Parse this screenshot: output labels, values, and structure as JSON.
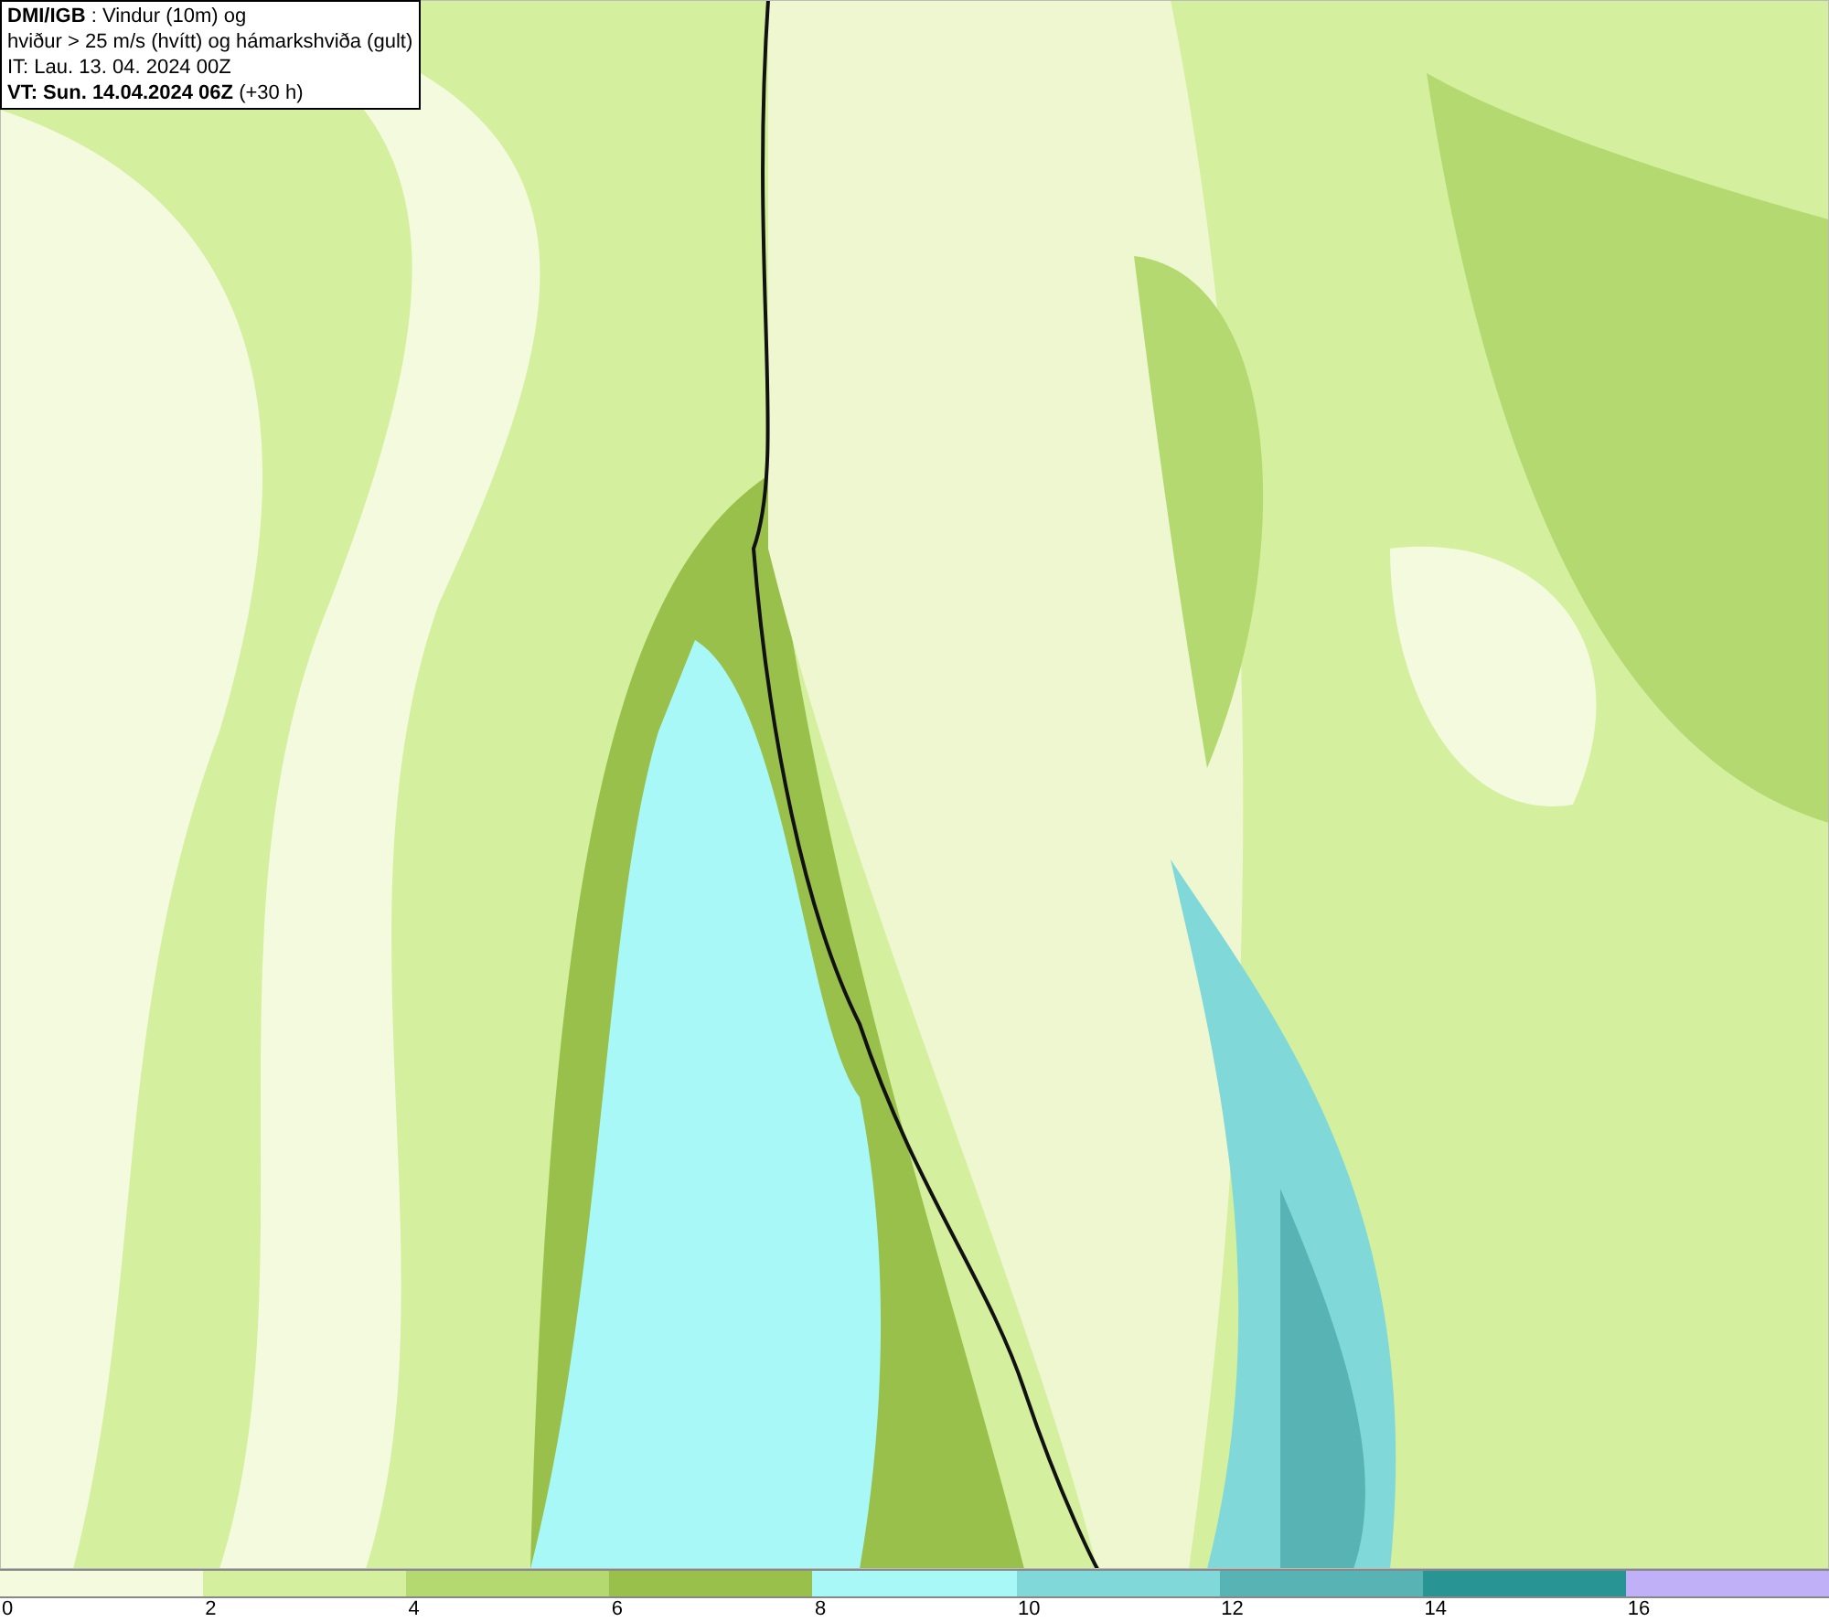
{
  "header": {
    "lines": [
      "**DMI/IGB** : Vindur (10m) og",
      "hviður > 25 m/s (hvítt) og hámarkshviða (gult)",
      "IT: Lau. 13. 04. 2024 00Z",
      "**VT: Sun. 14.04.2024 06Z** (+30 h)"
    ]
  },
  "legend": {
    "bins": [
      {
        "color": "#f4fade",
        "label": "0"
      },
      {
        "color": "#d4ef9e",
        "label": "2"
      },
      {
        "color": "#b4d970",
        "label": "4"
      },
      {
        "color": "#98c04a",
        "label": "6"
      },
      {
        "color": "#a8f8f8",
        "label": "8"
      },
      {
        "color": "#80d8d8",
        "label": "10"
      },
      {
        "color": "#58b4b4",
        "label": "12"
      },
      {
        "color": "#289494",
        "label": "14"
      },
      {
        "color": "#c0b0f8",
        "label": "16"
      }
    ]
  }
}
